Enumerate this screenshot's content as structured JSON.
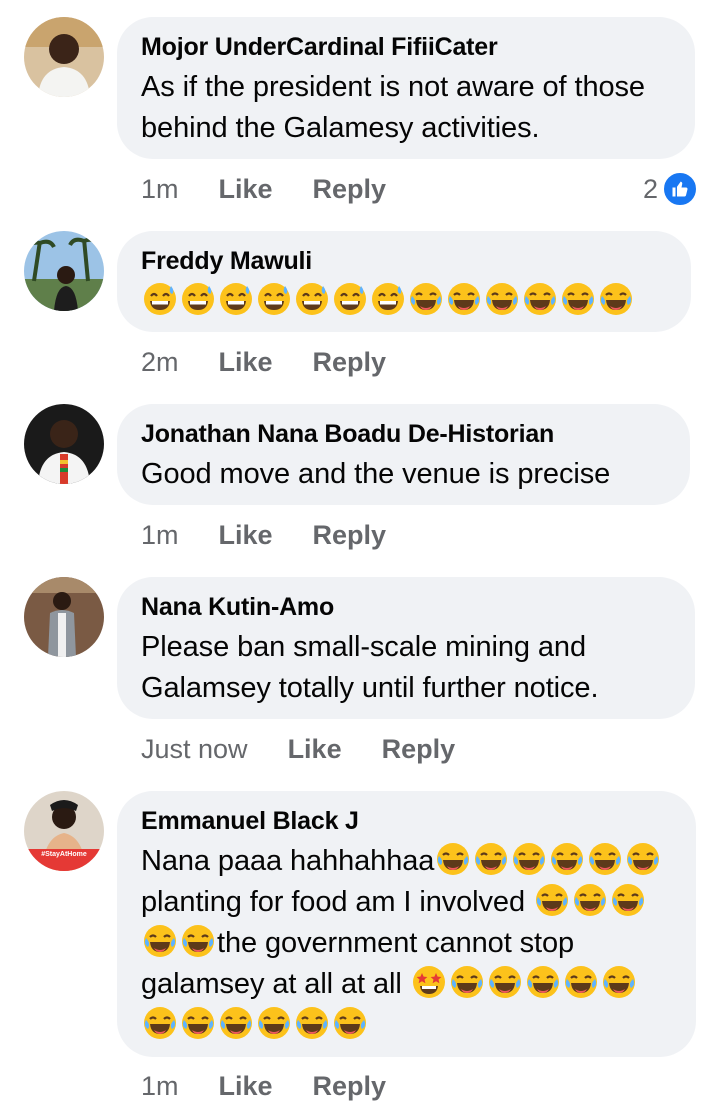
{
  "comments": [
    {
      "author": "Mojor UnderCardinal FifiiCater",
      "text": "As if the president is not aware of those behind the Galamesy activities.",
      "time": "1m",
      "like_label": "Like",
      "reply_label": "Reply",
      "reaction_count": "2",
      "reaction_icon": "like-icon"
    },
    {
      "author": "Freddy Mawuli",
      "text": "😅😅😅😅😅😅😅😂😂😂😂😂😂",
      "time": "2m",
      "like_label": "Like",
      "reply_label": "Reply"
    },
    {
      "author": "Jonathan Nana Boadu De-Historian",
      "text": "Good move and the venue is precise",
      "time": "1m",
      "like_label": "Like",
      "reply_label": "Reply"
    },
    {
      "author": "Nana Kutin-Amo",
      "text": "Please ban small-scale mining and Galamsey totally until further notice.",
      "time": "Just now",
      "like_label": "Like",
      "reply_label": "Reply"
    },
    {
      "author": "Emmanuel Black J",
      "text": "Nana paaa hahhahhaa😂😂😂😂😂😂planting for food am I involved 😂😂😂😂😂the government cannot stop galamsey at all at all 🤩😂😂😂😂😂😂😂😂😂😂😂",
      "time": "1m",
      "like_label": "Like",
      "reply_label": "Reply",
      "avatar_badge": "#StayAtHome"
    }
  ],
  "colors": {
    "bubble": "#f0f2f5",
    "meta_text": "#65676b",
    "like_blue": "#1877f2"
  }
}
